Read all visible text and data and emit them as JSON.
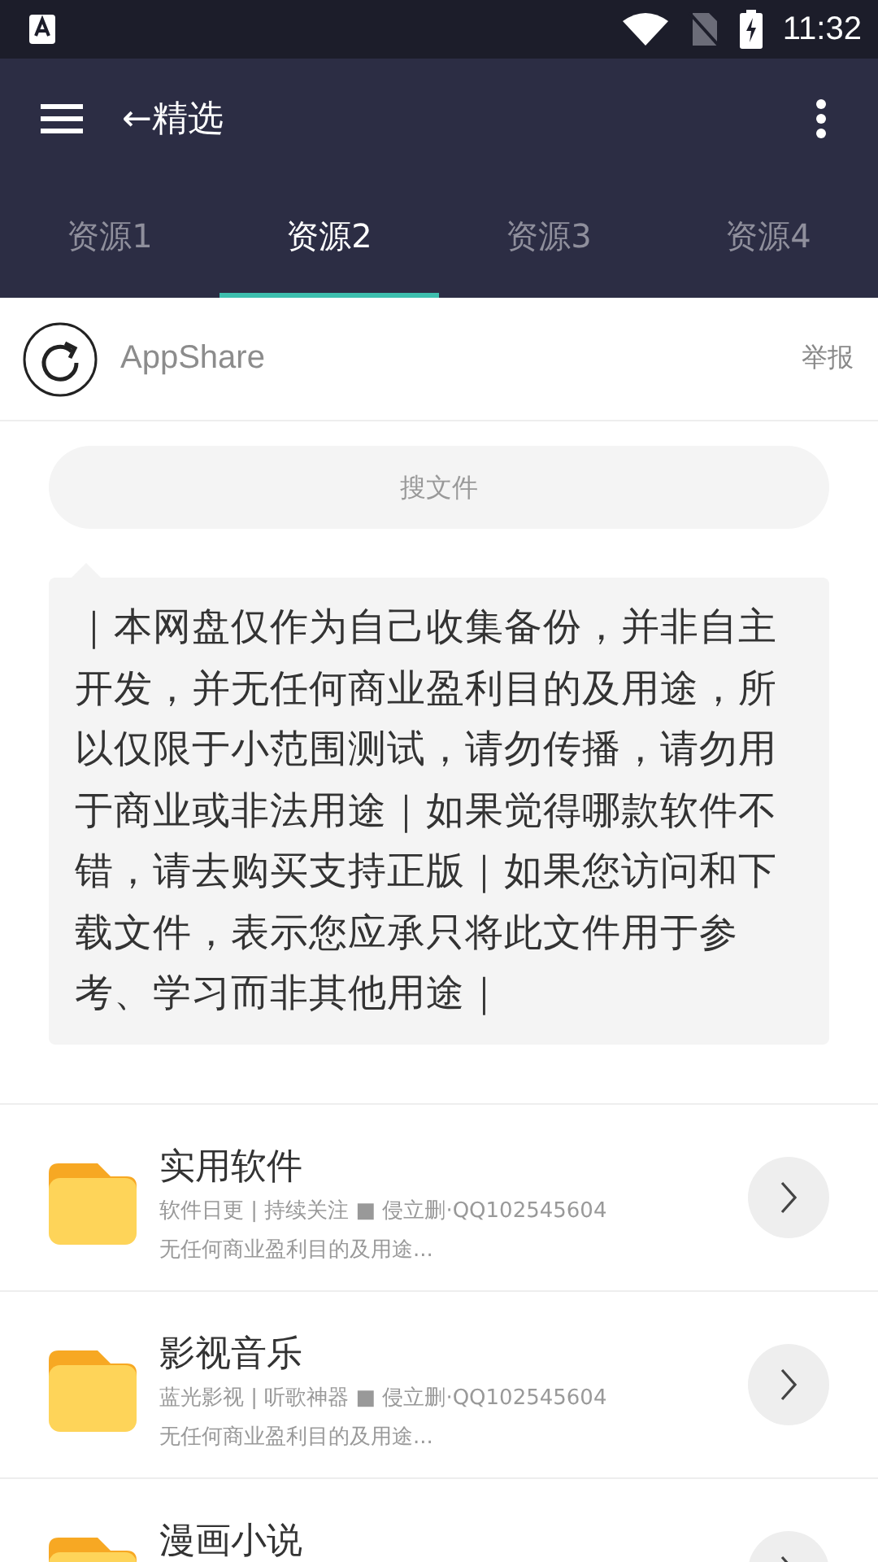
{
  "status_bar": {
    "time": "11:32"
  },
  "toolbar": {
    "title": "←精选"
  },
  "tabs": [
    {
      "label": "资源1",
      "selected": false
    },
    {
      "label": "资源2",
      "selected": true
    },
    {
      "label": "资源3",
      "selected": false
    },
    {
      "label": "资源4",
      "selected": false
    }
  ],
  "owner": {
    "name": "AppShare",
    "report": "举报"
  },
  "search": {
    "placeholder": "搜文件"
  },
  "notice": "｜本网盘仅作为自己收集备份，并非自主开发，并无任何商业盈利目的及用途，所以仅限于小范围测试，请勿传播，请勿用于商业或非法用途｜如果觉得哪款软件不错，请去购买支持正版｜如果您访问和下载文件，表示您应承只将此文件用于参考、学习而非其他用途｜",
  "folders": [
    {
      "title": "实用软件",
      "subtitle": "软件日更 | 持续关注 ■ 侵立删·QQ102545604",
      "description": "无任何商业盈利目的及用途..."
    },
    {
      "title": "影视音乐",
      "subtitle": "蓝光影视 | 听歌神器 ■ 侵立删·QQ102545604",
      "description": "无任何商业盈利目的及用途..."
    },
    {
      "title": "漫画小说"
    }
  ]
}
